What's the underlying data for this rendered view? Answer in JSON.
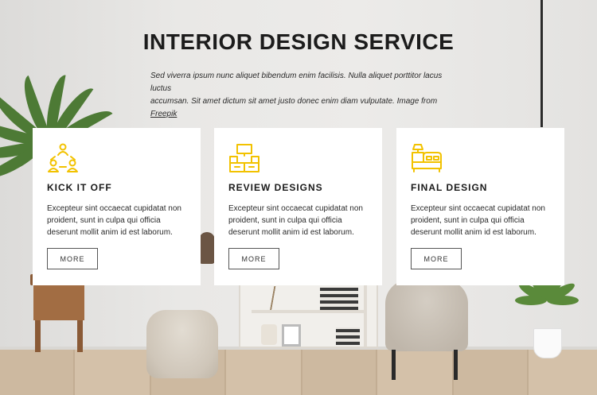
{
  "header": {
    "title": "INTERIOR DESIGN SERVICE",
    "intro_line1": "Sed viverra ipsum nunc aliquet bibendum enim facilisis. Nulla aliquet porttitor lacus luctus",
    "intro_line2_text": "accumsan. Sit amet dictum sit amet justo donec enim diam vulputate.  Image from ",
    "intro_link": "Freepik"
  },
  "cards": [
    {
      "icon": "team-meeting-icon",
      "title": "KICK IT OFF",
      "text": "Excepteur sint occaecat cupidatat non proident, sunt in culpa qui officia deserunt mollit anim id est laborum.",
      "button": "MORE"
    },
    {
      "icon": "furniture-layout-icon",
      "title": "REVIEW DESIGNS",
      "text": "Excepteur sint occaecat cupidatat non proident, sunt in culpa qui officia deserunt mollit anim id est laborum.",
      "button": "MORE"
    },
    {
      "icon": "bedroom-icon",
      "title": "FINAL DESIGN",
      "text": "Excepteur sint occaecat cupidatat non proident, sunt in culpa qui officia deserunt mollit anim id est laborum.",
      "button": "MORE"
    }
  ],
  "colors": {
    "accent": "#f2c200",
    "text": "#1c1c1c",
    "card_bg": "#ffffff"
  }
}
